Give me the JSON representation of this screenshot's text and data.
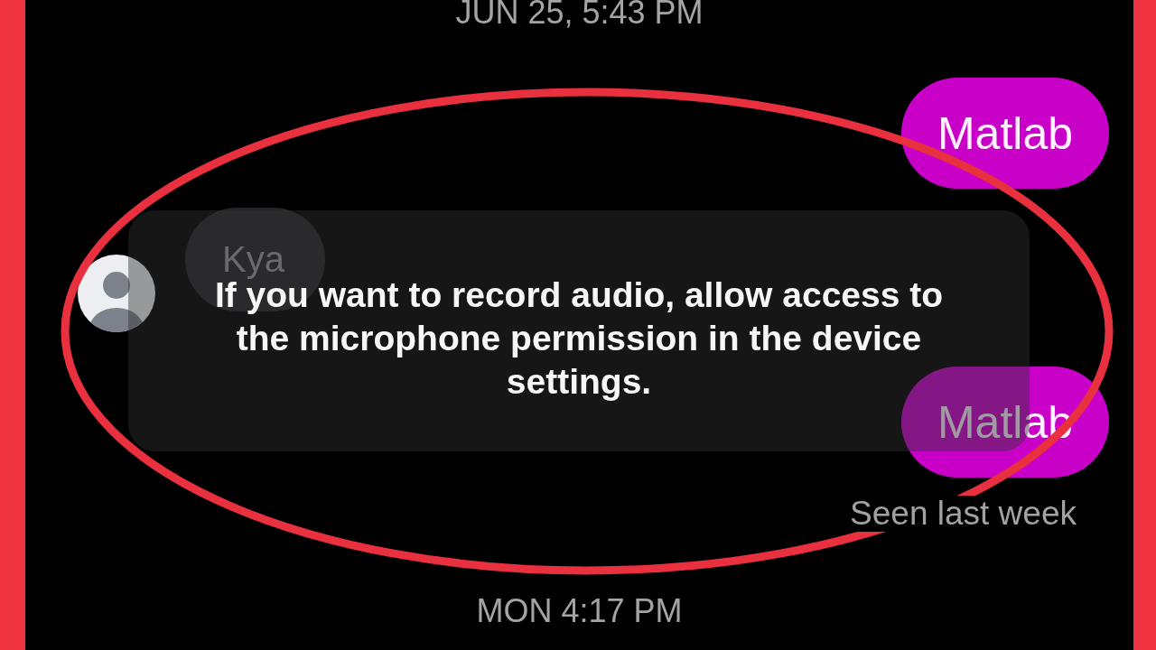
{
  "messages": [
    {
      "kind": "timestamp",
      "text": "JUN 25, 5:43 PM"
    },
    {
      "kind": "outgoing",
      "text": "Matlab"
    },
    {
      "kind": "incoming",
      "text": "Kya"
    },
    {
      "kind": "outgoing",
      "text": "Matlab"
    },
    {
      "kind": "receipt",
      "text": "Seen last week"
    },
    {
      "kind": "timestamp",
      "text": "MON 4:17 PM"
    }
  ],
  "toast": {
    "text": "If you want to record audio, allow access to the microphone permission in the device settings."
  },
  "highlight": {
    "kind": "ellipse"
  }
}
